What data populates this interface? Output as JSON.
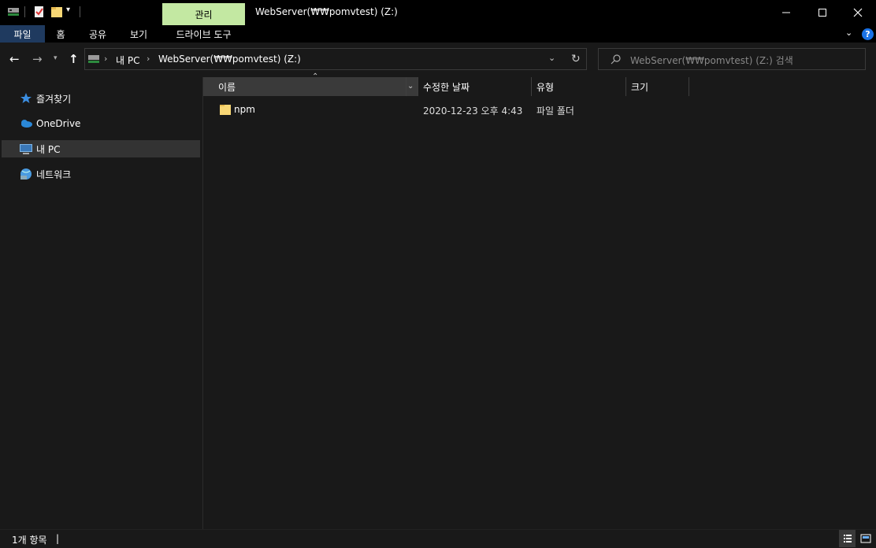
{
  "window": {
    "title": "WebServer(₩₩pomvtest) (Z:)",
    "context_tab": "관리"
  },
  "ribbon": {
    "tabs": [
      "파일",
      "홈",
      "공유",
      "보기",
      "드라이브 도구"
    ],
    "help": "?"
  },
  "address": {
    "crumbs": [
      "내 PC",
      "WebServer(₩₩pomvtest) (Z:)"
    ],
    "search_placeholder": "WebServer(₩₩pomvtest) (Z:) 검색"
  },
  "nav": {
    "items": [
      {
        "label": "즐겨찾기",
        "icon": "star-icon"
      },
      {
        "label": "OneDrive",
        "icon": "cloud-icon"
      },
      {
        "label": "내 PC",
        "icon": "computer-icon"
      },
      {
        "label": "네트워크",
        "icon": "network-icon"
      }
    ]
  },
  "table": {
    "columns": [
      "이름",
      "수정한 날짜",
      "유형",
      "크기"
    ],
    "rows": [
      {
        "name": "npm",
        "date": "2020-12-23 오후 4:43",
        "type": "파일 폴더",
        "size": ""
      }
    ]
  },
  "status": {
    "count": "1개 항목",
    "cursor": "|"
  },
  "colors": {
    "accent_tab": "#1f3a5f",
    "context_tab": "#c3e8a2",
    "folder": "#f8d775",
    "help": "#1a73e8"
  }
}
